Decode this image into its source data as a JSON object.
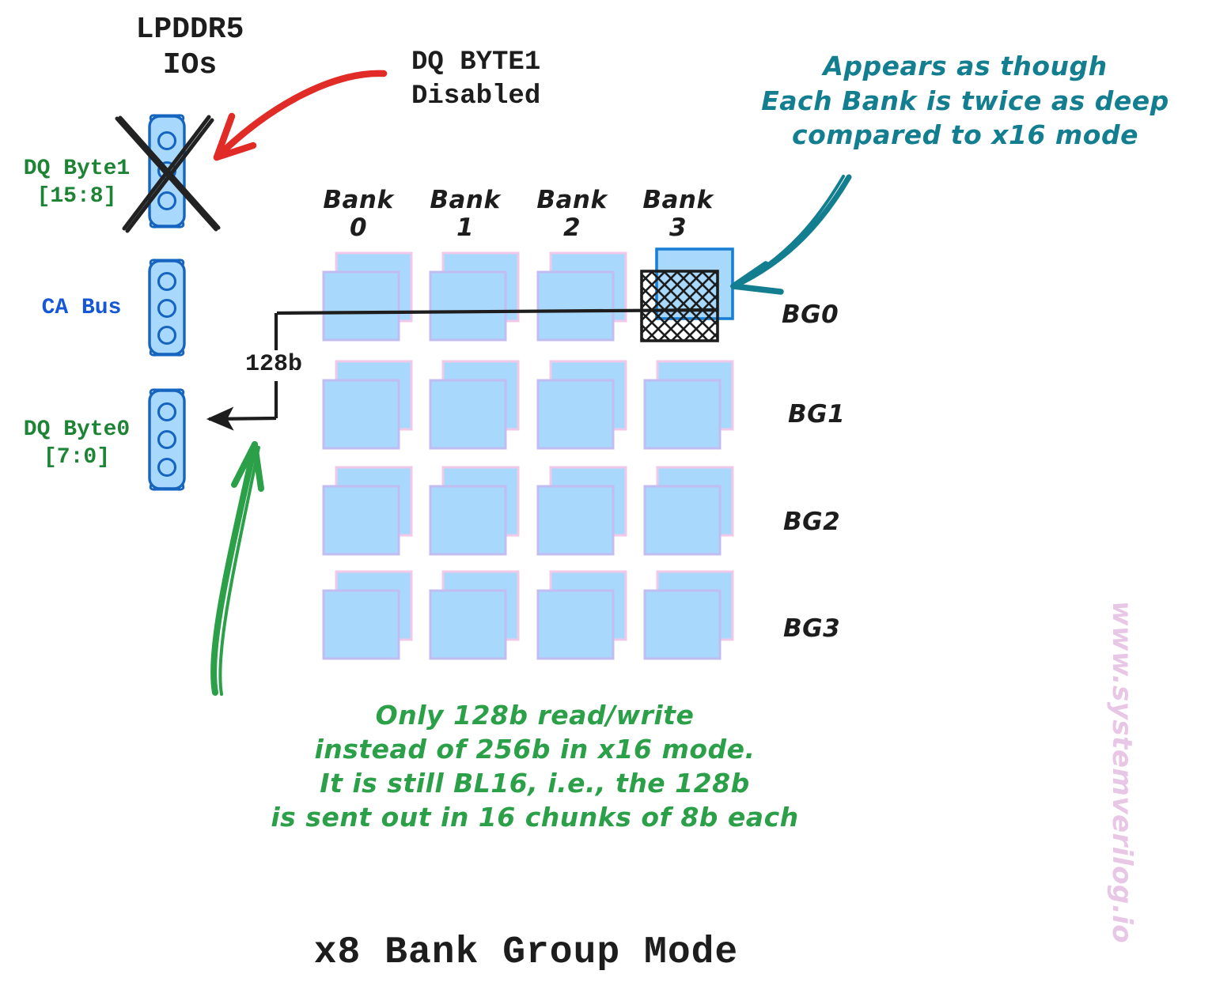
{
  "diagram": {
    "title": "x8 Bank Group Mode",
    "lpddr5_io_heading": "LPDDR5\nIOs",
    "disabled_note": "DQ BYTE1\nDisabled",
    "bus_width_label": "128b",
    "watermark": "www.systemverilog.io"
  },
  "io_blocks": [
    {
      "name": "dq-byte1",
      "label": "DQ Byte1\n[15:8]",
      "color": "#1e8435",
      "disabled": true
    },
    {
      "name": "ca-bus",
      "label": "CA Bus",
      "color": "#1558d6",
      "disabled": false
    },
    {
      "name": "dq-byte0",
      "label": "DQ Byte0\n[7:0]",
      "color": "#1e8435",
      "disabled": false
    }
  ],
  "bank_headers": [
    {
      "label": "Bank\n0"
    },
    {
      "label": "Bank\n1"
    },
    {
      "label": "Bank\n2"
    },
    {
      "label": "Bank\n3"
    }
  ],
  "bank_groups": [
    {
      "label": "BG0"
    },
    {
      "label": "BG1"
    },
    {
      "label": "BG2"
    },
    {
      "label": "BG3"
    }
  ],
  "annotations": {
    "teal_note": "Appears as though\nEach Bank is twice as deep\ncompared to x16 mode",
    "green_note": "Only 128b read/write\ninstead of 256b in x16 mode.\nIt is still BL16, i.e., the 128b\nis sent out in 16 chunks of 8b each"
  },
  "colors": {
    "bank_fill": "#a8d8fb",
    "bank_back_border": "#f0c8e8",
    "bank_front_border": "#9e9ae0",
    "highlight_border": "#1a7fd4",
    "io_fill": "#a8d8fb",
    "io_stroke": "#1565c0",
    "red_arrow": "#e02b27",
    "teal_arrow": "#127e8f",
    "green_arrow": "#2ba049",
    "black": "#1d1d1d",
    "watermark": "#e8c6e6"
  }
}
